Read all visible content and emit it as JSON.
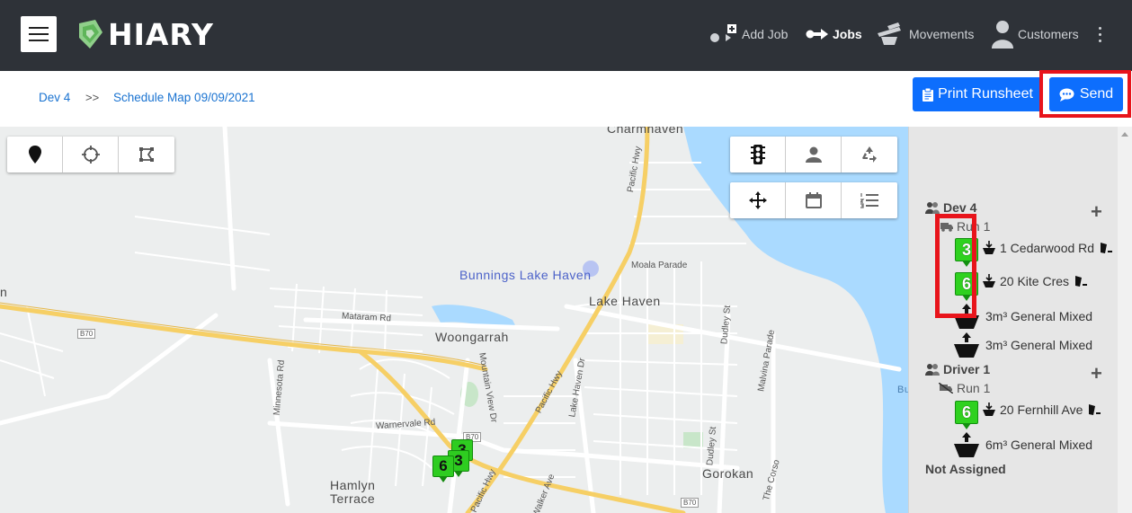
{
  "app": {
    "logo_text": "HIARY"
  },
  "nav": {
    "add_job": "Add Job",
    "jobs": "Jobs",
    "movements": "Movements",
    "customers": "Customers"
  },
  "breadcrumb": {
    "root": "Dev 4",
    "separator": ">>",
    "current": "Schedule Map 09/09/2021"
  },
  "buttons": {
    "print": "Print Runsheet",
    "send": "Send"
  },
  "colors": {
    "header": "#2e3238",
    "primary": "#0d6efd",
    "highlight": "#e8141b",
    "pin": "#2ecc20"
  },
  "map": {
    "places": {
      "charmhaven": "Charmhaven",
      "bunnings": "Bunnings Lake Haven",
      "lake_haven": "Lake Haven",
      "woongarrah": "Woongarrah",
      "hamlyn": "Hamlyn",
      "terrace": "Terrace",
      "gorokan": "Gorokan",
      "bu": "Bu",
      "n": "n"
    },
    "roads": {
      "pacific1": "Pacific Hwy",
      "pacific2": "Pacific Hwy",
      "pacific3": "Pacific Hwy",
      "moala": "Moala Parade",
      "mataram": "Mataram Rd",
      "minnesota": "Minnesota Rd",
      "mountview": "Mountain View Dr",
      "warnervale": "Warnervale Rd",
      "lakehaven": "Lake Haven Dr",
      "walker": "Walker Ave",
      "dudley1": "Dudley St",
      "dudley2": "Dudley St",
      "malvina": "Malvina Parade",
      "corso": "The Corso",
      "b70a": "B70",
      "b70b": "B70",
      "b70c": "B70"
    },
    "pins": [
      {
        "label": "6"
      },
      {
        "label": "3"
      },
      {
        "label": "6"
      }
    ]
  },
  "panel": {
    "groups": [
      {
        "name": "Dev 4",
        "run": "Run 1",
        "stops": [
          {
            "pin": "3",
            "address": "1 Cedarwood Rd"
          },
          {
            "pin": "6",
            "address": "20 Kite Cres"
          }
        ],
        "loads": [
          "3m³ General Mixed",
          "3m³ General Mixed"
        ]
      },
      {
        "name": "Driver 1",
        "run": "Run 1",
        "stops": [
          {
            "pin": "6",
            "address": "20 Fernhill Ave"
          }
        ],
        "loads": [
          "6m³ General Mixed"
        ]
      }
    ],
    "not_assigned": "Not Assigned"
  }
}
